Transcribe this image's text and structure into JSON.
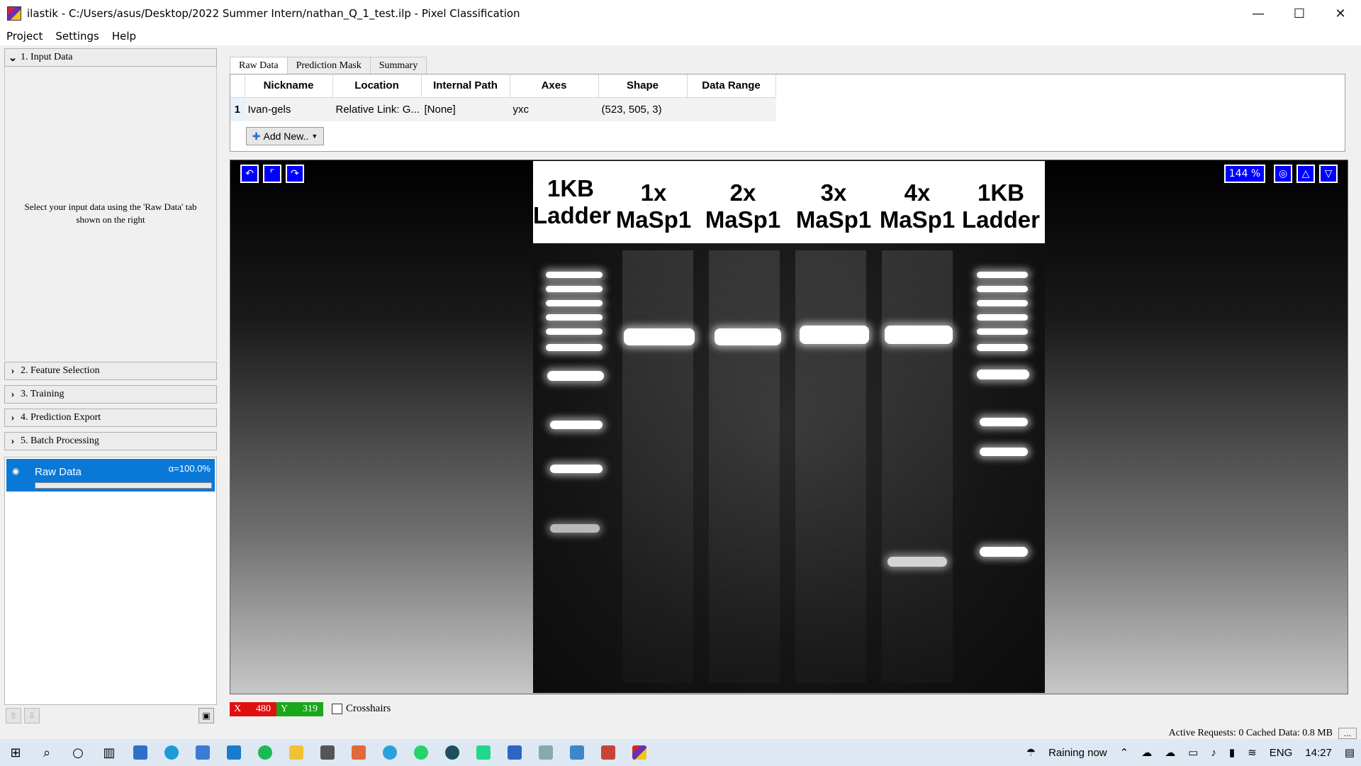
{
  "window": {
    "title": "ilastik - C:/Users/asus/Desktop/2022 Summer Intern/nathan_Q_1_test.ilp - Pixel Classification",
    "minimize": "—",
    "maximize": "☐",
    "close": "✕"
  },
  "menu": [
    "Project",
    "Settings",
    "Help"
  ],
  "applets": {
    "input": "1. Input Data",
    "input_hint": "Select your input data using the 'Raw Data' tab shown on the right",
    "feature": "2. Feature Selection",
    "training": "3. Training",
    "export": "4. Prediction Export",
    "batch": "5. Batch Processing"
  },
  "layers": {
    "raw": {
      "name": "Raw Data",
      "alpha": "α=100.0%",
      "opacity": 1.0
    }
  },
  "tabs": [
    "Raw Data",
    "Prediction Mask",
    "Summary"
  ],
  "table": {
    "headers": [
      "Nickname",
      "Location",
      "Internal Path",
      "Axes",
      "Shape",
      "Data Range"
    ],
    "rows": [
      {
        "index": "1",
        "cells": [
          "Ivan-gels",
          "Relative Link: G...",
          "[None]",
          "yxc",
          "(523, 505, 3)",
          ""
        ]
      }
    ],
    "add_new": "Add New.."
  },
  "viewer": {
    "zoom": "144 %",
    "gel_labels": [
      [
        "1KB",
        "Ladder"
      ],
      [
        "1x",
        "MaSp1"
      ],
      [
        "2x",
        "MaSp1"
      ],
      [
        "3x",
        "MaSp1"
      ],
      [
        "4x",
        "MaSp1"
      ],
      [
        "1KB",
        "Ladder"
      ]
    ]
  },
  "status": {
    "x_label": "X",
    "x": "480",
    "y_label": "Y",
    "y": "319",
    "crosshairs": "Crosshairs",
    "right": "Active Requests: 0  Cached Data: 0.8 MB",
    "more": "..."
  },
  "taskbar": {
    "weather": "Raining now",
    "lang": "ENG",
    "time": "14:27"
  },
  "colors": {
    "accent": "#0a78d7",
    "viewer_btn": "#0000ff",
    "x_bg": "#e01010",
    "y_bg": "#18a818"
  }
}
